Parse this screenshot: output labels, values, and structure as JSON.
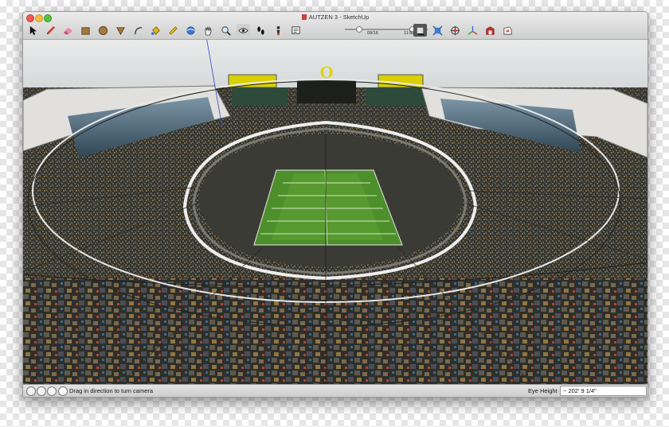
{
  "window": {
    "title": "AUTZEN 3 - SketchUp",
    "controls": [
      "close",
      "minimize",
      "zoom"
    ]
  },
  "toolbar": {
    "tools": [
      {
        "name": "select-tool",
        "icon": "arrow-cursor-icon",
        "tip": "Select"
      },
      {
        "name": "line-tool",
        "icon": "pencil-icon",
        "tip": "Line"
      },
      {
        "name": "eraser-tool",
        "icon": "eraser-icon",
        "tip": "Eraser"
      },
      {
        "name": "rectangle-tool",
        "icon": "rectangle-icon",
        "tip": "Rectangle"
      },
      {
        "name": "circle-tool",
        "icon": "circle-icon",
        "tip": "Circle"
      },
      {
        "name": "polygon-tool",
        "icon": "polygon-icon",
        "tip": "Polygon"
      },
      {
        "name": "arc-tool",
        "icon": "arc-icon",
        "tip": "Arc"
      },
      {
        "name": "paint-bucket-tool",
        "icon": "paint-bucket-icon",
        "tip": "Paint Bucket"
      },
      {
        "name": "tape-measure-tool",
        "icon": "tape-measure-icon",
        "tip": "Tape Measure"
      },
      {
        "name": "orbit-tool",
        "icon": "orbit-icon",
        "tip": "Orbit"
      },
      {
        "name": "pan-tool",
        "icon": "hand-icon",
        "tip": "Pan"
      },
      {
        "name": "zoom-tool",
        "icon": "magnifier-icon",
        "tip": "Zoom"
      },
      {
        "name": "look-around-tool",
        "icon": "eye-icon",
        "tip": "Look Around"
      },
      {
        "name": "walk-tool",
        "icon": "footsteps-icon",
        "tip": "Walk"
      },
      {
        "name": "position-camera-tool",
        "icon": "camera-person-icon",
        "tip": "Position Camera"
      },
      {
        "name": "scenes-tool",
        "icon": "scenes-icon",
        "tip": "Scenes"
      }
    ],
    "shadow": {
      "date": "09/16",
      "time": "11:52 AM",
      "date_fraction": 0.71,
      "time_fraction": 0.47
    },
    "right_tools": [
      {
        "name": "shadows-toggle",
        "icon": "shadow-box-icon",
        "active": true
      },
      {
        "name": "zoom-extents-tool",
        "icon": "zoom-extents-icon"
      },
      {
        "name": "section-plane-tool",
        "icon": "section-plane-icon"
      },
      {
        "name": "axes-tool",
        "icon": "axes-icon"
      },
      {
        "name": "warehouse-tool",
        "icon": "warehouse-icon"
      },
      {
        "name": "share-model-tool",
        "icon": "share-model-icon"
      }
    ]
  },
  "scene": {
    "description_alt": "3D model of Autzen Stadium",
    "colors": {
      "field": "#4d8f2b",
      "crowd": "#3b3c36",
      "sky": "#dfe3e4",
      "roof": "#3f5f72"
    }
  },
  "status": {
    "icons": [
      "geo-location-icon",
      "credits-icon",
      "user-icon",
      "help-icon"
    ],
    "message": "Drag in direction to turn camera",
    "measurement_label": "Eye Height",
    "measurement_value": "~ 202' 9 1/4\""
  }
}
